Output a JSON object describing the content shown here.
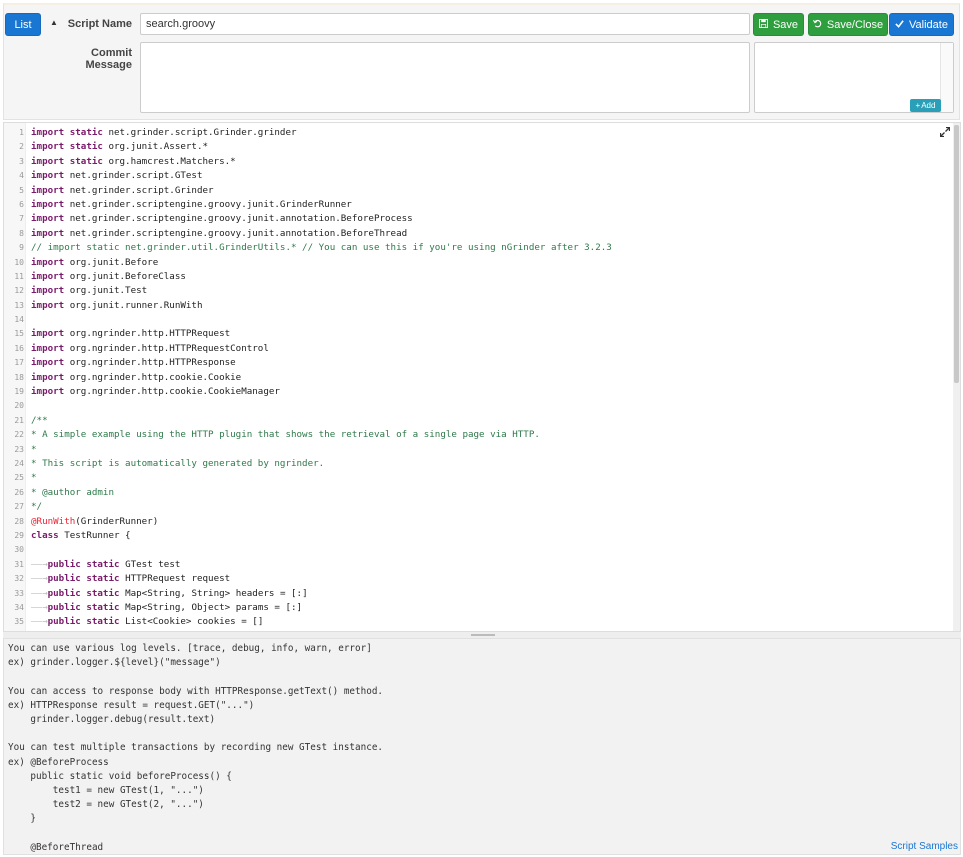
{
  "header": {
    "list_label": "List",
    "script_name_label": "Script Name",
    "script_name_value": "search.groovy",
    "commit_label": "Commit Message",
    "commit_value": "",
    "save_label": "Save",
    "save_close_label": "Save/Close",
    "validate_label": "Validate",
    "add_label": "Add"
  },
  "editor": {
    "lines": [
      [
        {
          "t": "import static ",
          "c": "kw"
        },
        {
          "t": "net.grinder.script.Grinder.grinder"
        }
      ],
      [
        {
          "t": "import static ",
          "c": "kw"
        },
        {
          "t": "org.junit.Assert.*"
        }
      ],
      [
        {
          "t": "import static ",
          "c": "kw"
        },
        {
          "t": "org.hamcrest.Matchers.*"
        }
      ],
      [
        {
          "t": "import ",
          "c": "kw"
        },
        {
          "t": "net.grinder.script.GTest"
        }
      ],
      [
        {
          "t": "import ",
          "c": "kw"
        },
        {
          "t": "net.grinder.script.Grinder"
        }
      ],
      [
        {
          "t": "import ",
          "c": "kw"
        },
        {
          "t": "net.grinder.scriptengine.groovy.junit.GrinderRunner"
        }
      ],
      [
        {
          "t": "import ",
          "c": "kw"
        },
        {
          "t": "net.grinder.scriptengine.groovy.junit.annotation.BeforeProcess"
        }
      ],
      [
        {
          "t": "import ",
          "c": "kw"
        },
        {
          "t": "net.grinder.scriptengine.groovy.junit.annotation.BeforeThread"
        }
      ],
      [
        {
          "t": "// import static net.grinder.util.GrinderUtils.* // You can use this if you're using nGrinder after 3.2.3",
          "c": "cm"
        }
      ],
      [
        {
          "t": "import ",
          "c": "kw"
        },
        {
          "t": "org.junit.Before"
        }
      ],
      [
        {
          "t": "import ",
          "c": "kw"
        },
        {
          "t": "org.junit.BeforeClass"
        }
      ],
      [
        {
          "t": "import ",
          "c": "kw"
        },
        {
          "t": "org.junit.Test"
        }
      ],
      [
        {
          "t": "import ",
          "c": "kw"
        },
        {
          "t": "org.junit.runner.RunWith"
        }
      ],
      [],
      [
        {
          "t": "import ",
          "c": "kw"
        },
        {
          "t": "org.ngrinder.http.HTTPRequest"
        }
      ],
      [
        {
          "t": "import ",
          "c": "kw"
        },
        {
          "t": "org.ngrinder.http.HTTPRequestControl"
        }
      ],
      [
        {
          "t": "import ",
          "c": "kw"
        },
        {
          "t": "org.ngrinder.http.HTTPResponse"
        }
      ],
      [
        {
          "t": "import ",
          "c": "kw"
        },
        {
          "t": "org.ngrinder.http.cookie.Cookie"
        }
      ],
      [
        {
          "t": "import ",
          "c": "kw"
        },
        {
          "t": "org.ngrinder.http.cookie.CookieManager"
        }
      ],
      [],
      [
        {
          "t": "/**",
          "c": "cm"
        }
      ],
      [
        {
          "t": "* A simple example using the HTTP plugin that shows the retrieval of a single page via HTTP.",
          "c": "cm"
        }
      ],
      [
        {
          "t": "*",
          "c": "cm"
        }
      ],
      [
        {
          "t": "* This script is automatically generated by ngrinder.",
          "c": "cm"
        }
      ],
      [
        {
          "t": "*",
          "c": "cm"
        }
      ],
      [
        {
          "t": "* @author admin",
          "c": "cm"
        }
      ],
      [
        {
          "t": "*/",
          "c": "cm"
        }
      ],
      [
        {
          "t": "@RunWith",
          "c": "an"
        },
        {
          "t": "(GrinderRunner)"
        }
      ],
      [
        {
          "t": "class ",
          "c": "kw"
        },
        {
          "t": "TestRunner {"
        }
      ],
      [],
      [
        {
          "t": "——→",
          "c": "tab"
        },
        {
          "t": "public static ",
          "c": "kw"
        },
        {
          "t": "GTest test"
        }
      ],
      [
        {
          "t": "——→",
          "c": "tab"
        },
        {
          "t": "public static ",
          "c": "kw"
        },
        {
          "t": "HTTPRequest request"
        }
      ],
      [
        {
          "t": "——→",
          "c": "tab"
        },
        {
          "t": "public static ",
          "c": "kw"
        },
        {
          "t": "Map<String, String> headers = [:]"
        }
      ],
      [
        {
          "t": "——→",
          "c": "tab"
        },
        {
          "t": "public static ",
          "c": "kw"
        },
        {
          "t": "Map<String, Object> params = [:]"
        }
      ],
      [
        {
          "t": "——→",
          "c": "tab"
        },
        {
          "t": "public static ",
          "c": "kw"
        },
        {
          "t": "List<Cookie> cookies = []"
        }
      ]
    ]
  },
  "help": {
    "text": "You can use various log levels. [trace, debug, info, warn, error]\nex) grinder.logger.${level}(\"message\")\n\nYou can access to response body with HTTPResponse.getText() method.\nex) HTTPResponse result = request.GET(\"...\")\n    grinder.logger.debug(result.text)\n\nYou can test multiple transactions by recording new GTest instance.\nex) @BeforeProcess\n    public static void beforeProcess() {\n        test1 = new GTest(1, \"...\")\n        test2 = new GTest(2, \"...\")\n    }\n\n    @BeforeThread",
    "samples_label": "Script Samples"
  }
}
